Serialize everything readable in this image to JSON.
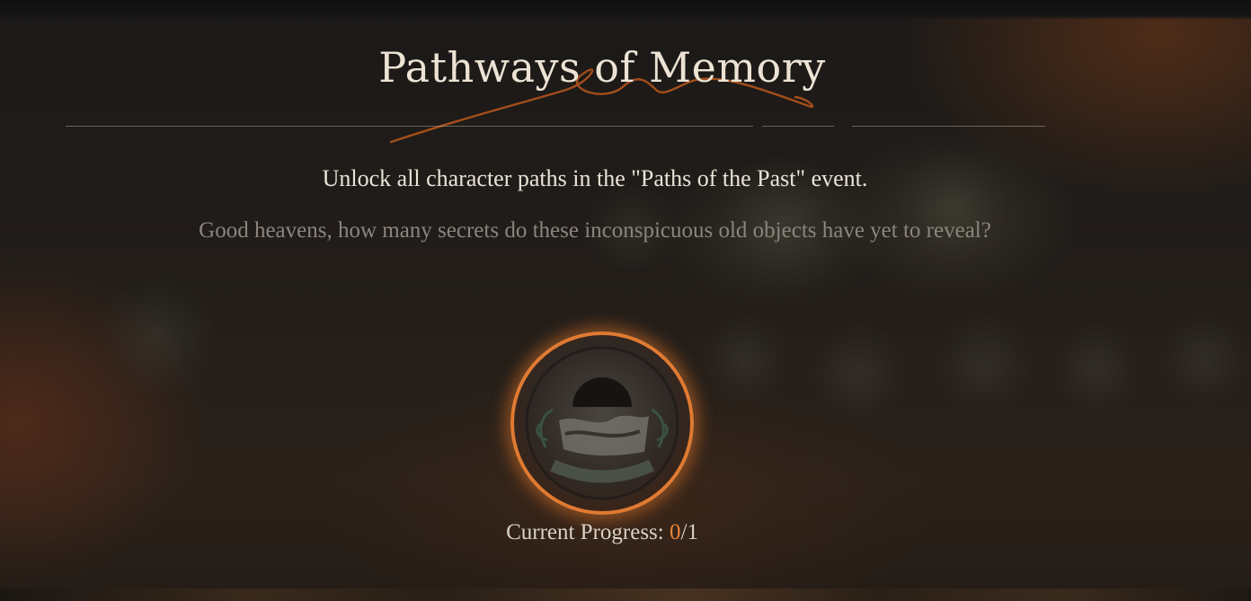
{
  "achievement": {
    "title": "Pathways of Memory",
    "goal": "Unlock all character paths in the \"Paths of the Past\" event.",
    "flavor": "Good heavens, how many secrets do these inconspicuous old objects have yet to reveal?",
    "badge_icon": "ornate-medallion-icon",
    "progress": {
      "label": "Current Progress: ",
      "current": "0",
      "separator": "/",
      "total": "1"
    }
  },
  "colors": {
    "accent": "#e8853c",
    "title_text": "#ece3d4",
    "flavor_text": "#8a857d"
  }
}
